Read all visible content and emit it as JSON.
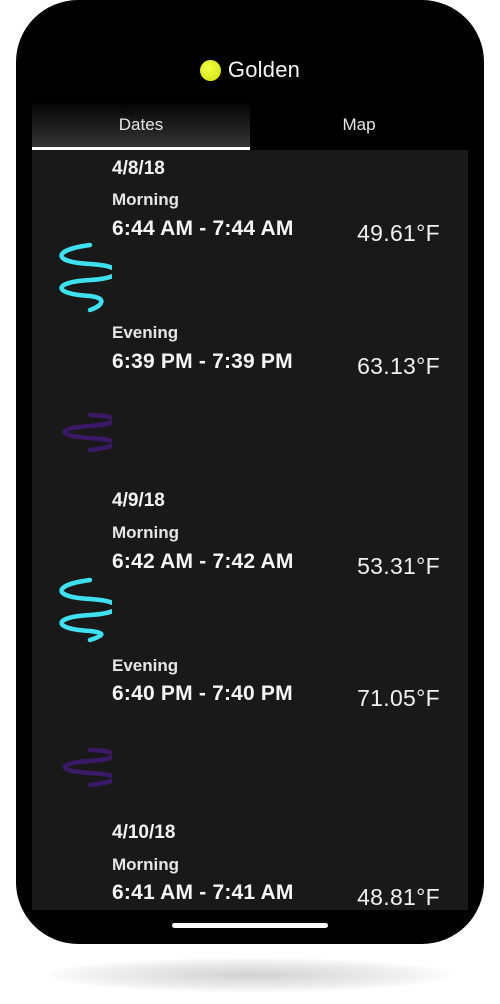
{
  "app": {
    "title": "Golden",
    "sun_color": "#dfee1f"
  },
  "tabs": [
    {
      "label": "Dates",
      "active": true
    },
    {
      "label": "Map",
      "active": false
    }
  ],
  "days": [
    {
      "date": "4/8/18",
      "sessions": [
        {
          "period": "Morning",
          "start": "6:44 AM",
          "separator": "-",
          "end": "7:44 AM",
          "temperature": "49.61°F"
        },
        {
          "period": "Evening",
          "start": "6:39 PM",
          "separator": "-",
          "end": "7:39 PM",
          "temperature": "63.13°F"
        }
      ]
    },
    {
      "date": "4/9/18",
      "sessions": [
        {
          "period": "Morning",
          "start": "6:42 AM",
          "separator": "-",
          "end": "7:42 AM",
          "temperature": "53.31°F"
        },
        {
          "period": "Evening",
          "start": "6:40 PM",
          "separator": "-",
          "end": "7:40 PM",
          "temperature": "71.05°F"
        }
      ]
    },
    {
      "date": "4/10/18",
      "sessions": [
        {
          "period": "Morning",
          "start": "6:41 AM",
          "separator": "-",
          "end": "7:41 AM",
          "temperature": "48.81°F"
        }
      ]
    }
  ],
  "colors": {
    "morning_wave": "#3fe0f0",
    "evening_wave": "#3a1a66",
    "gradient": [
      "#e24a2a",
      "#ff8a3a",
      "#3fe0f0",
      "#ff7a5a",
      "#c03aa8",
      "#3a1a66"
    ]
  }
}
